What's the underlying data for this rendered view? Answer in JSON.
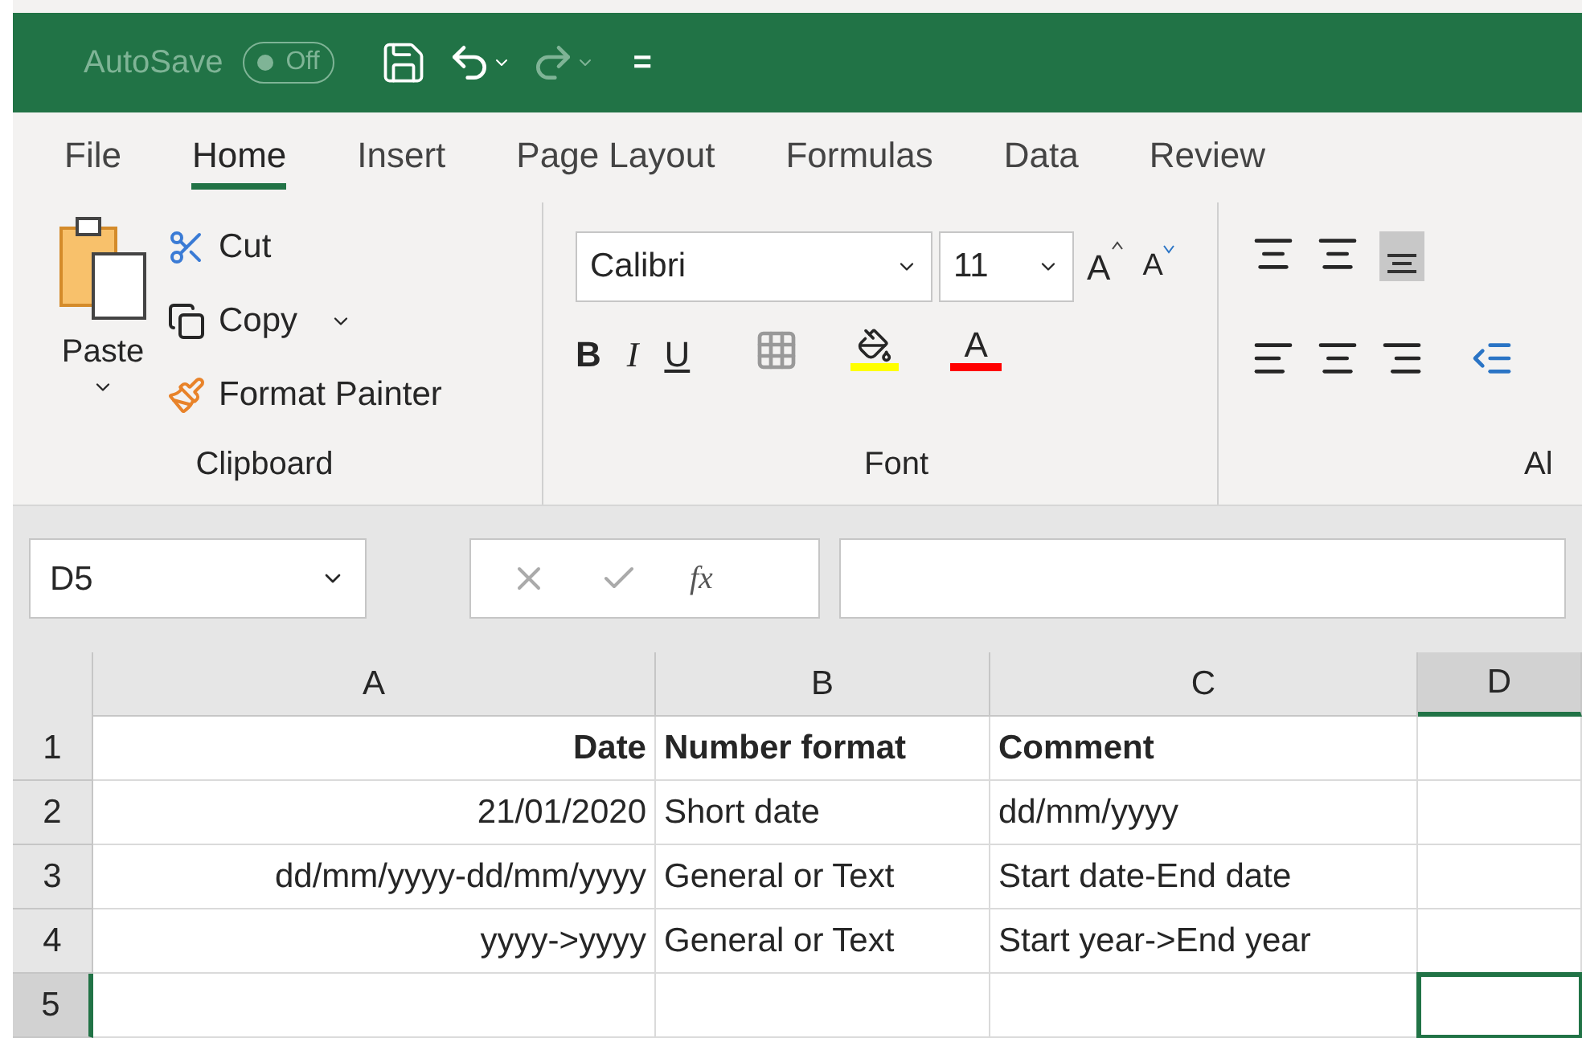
{
  "title_bar": {
    "autosave_label": "AutoSave",
    "autosave_toggle": {
      "label": "Off",
      "on": false
    },
    "quick_access_overflow": "="
  },
  "tabs": [
    {
      "label": "File",
      "selected": false
    },
    {
      "label": "Home",
      "selected": true
    },
    {
      "label": "Insert",
      "selected": false
    },
    {
      "label": "Page Layout",
      "selected": false
    },
    {
      "label": "Formulas",
      "selected": false
    },
    {
      "label": "Data",
      "selected": false
    },
    {
      "label": "Review",
      "selected": false
    }
  ],
  "ribbon": {
    "clipboard": {
      "paste": "Paste",
      "cut": "Cut",
      "copy": "Copy",
      "format_painter": "Format Painter",
      "label": "Clipboard"
    },
    "font": {
      "font_name": "Calibri",
      "font_size": "11",
      "bold": "B",
      "italic": "I",
      "underline": "U",
      "grow": "A",
      "shrink": "A",
      "font_color": "A",
      "label": "Font"
    },
    "alignment": {
      "label": "Al"
    }
  },
  "formula_bar": {
    "name_box": "D5",
    "function_label": "fx"
  },
  "sheet": {
    "columns": [
      {
        "label": "A",
        "right_aligned": true,
        "selected": false
      },
      {
        "label": "B",
        "right_aligned": false,
        "selected": false
      },
      {
        "label": "C",
        "right_aligned": false,
        "selected": false
      },
      {
        "label": "D",
        "right_aligned": false,
        "selected": true
      }
    ],
    "rows": [
      {
        "number": "1",
        "bold": true,
        "selected": false,
        "cells": [
          "Date",
          "Number format",
          "Comment"
        ]
      },
      {
        "number": "2",
        "bold": false,
        "selected": false,
        "cells": [
          "21/01/2020",
          "Short date",
          "dd/mm/yyyy"
        ]
      },
      {
        "number": "3",
        "bold": false,
        "selected": false,
        "cells": [
          "dd/mm/yyyy-dd/mm/yyyy",
          "General or Text",
          "Start date-End date"
        ]
      },
      {
        "number": "4",
        "bold": false,
        "selected": false,
        "cells": [
          "yyyy->yyyy",
          "General or Text",
          "Start year->End year"
        ]
      },
      {
        "number": "5",
        "bold": false,
        "selected": true
      }
    ]
  }
}
